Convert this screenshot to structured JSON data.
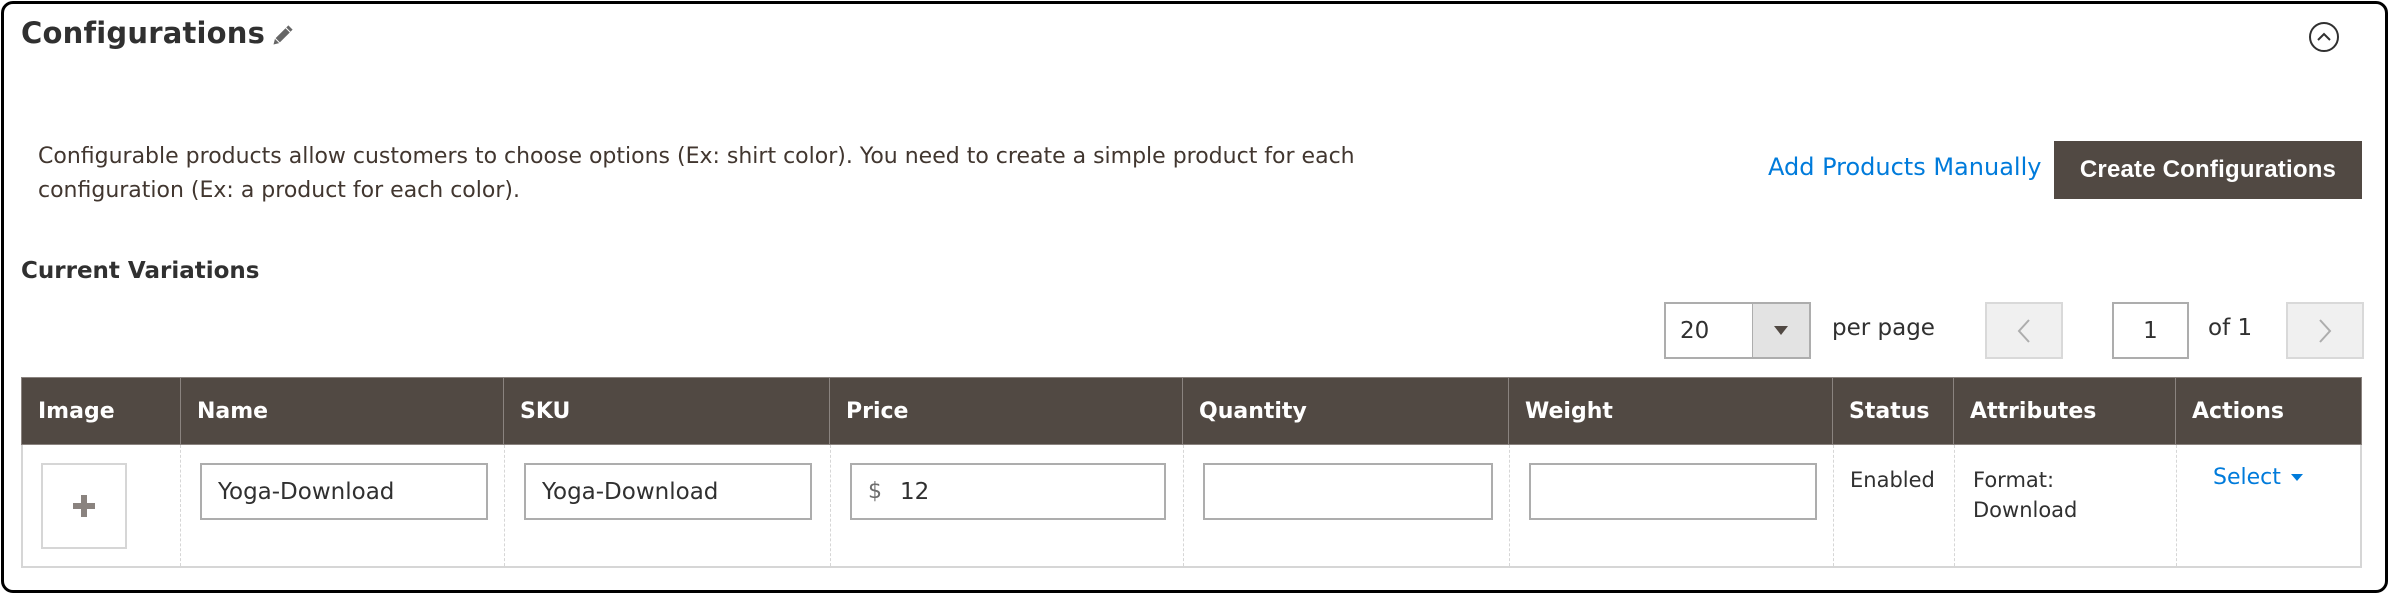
{
  "section": {
    "title": "Configurations",
    "edit_icon": "pencil-icon",
    "collapse_icon": "chevron-up-circle-icon"
  },
  "intro": {
    "description": "Configurable products allow customers to choose options (Ex: shirt color). You need to create a simple product for each configuration (Ex: a product for each color).",
    "add_products_manually_label": "Add Products Manually",
    "create_configurations_label": "Create Configurations"
  },
  "variations": {
    "heading": "Current Variations",
    "pagination": {
      "per_page_value": "20",
      "per_page_label": "per page",
      "current_page": "1",
      "of_label": "of 1",
      "prev_icon": "chevron-left-icon",
      "next_icon": "chevron-right-icon"
    },
    "columns": [
      "Image",
      "Name",
      "SKU",
      "Price",
      "Quantity",
      "Weight",
      "Status",
      "Attributes",
      "Actions"
    ],
    "rows": [
      {
        "image_icon": "plus-icon",
        "name": "Yoga-Download",
        "sku": "Yoga-Download",
        "price_currency": "$",
        "price": "12",
        "quantity": "",
        "weight": "",
        "status": "Enabled",
        "attributes": "Format: Download",
        "action_label": "Select"
      }
    ]
  },
  "colors": {
    "header_bg": "#514943",
    "primary_button": "#514943",
    "link": "#007bdb",
    "text": "#303030"
  }
}
